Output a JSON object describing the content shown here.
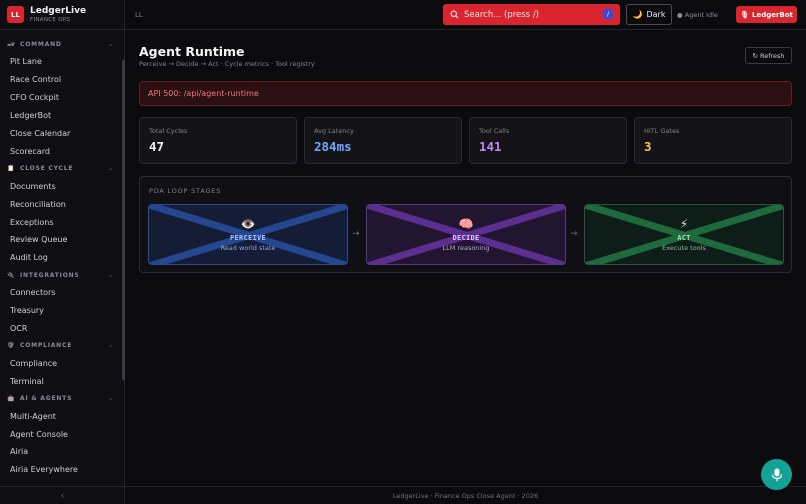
{
  "brand": {
    "logo": "LL",
    "title": "LedgerLive",
    "subtitle": "FINANCE OPS"
  },
  "header": {
    "breadcrumb": "LL",
    "search_placeholder": "Search... (press /)",
    "search_shortcut": "/",
    "theme_label": "Dark",
    "agent_status": "Agent Idle",
    "ledgerbot_label": "LedgerBot"
  },
  "sidebar": {
    "sections": [
      {
        "label": "COMMAND",
        "icon": "racecar-icon",
        "items": [
          "Pit Lane",
          "Race Control",
          "CFO Cockpit",
          "LedgerBot",
          "Close Calendar",
          "Scorecard"
        ]
      },
      {
        "label": "CLOSE CYCLE",
        "icon": "clipboard-icon",
        "items": [
          "Documents",
          "Reconciliation",
          "Exceptions",
          "Review Queue",
          "Audit Log"
        ]
      },
      {
        "label": "INTEGRATIONS",
        "icon": "plug-icon",
        "items": [
          "Connectors",
          "Treasury",
          "OCR"
        ]
      },
      {
        "label": "COMPLIANCE",
        "icon": "shield-icon",
        "items": [
          "Compliance",
          "Terminal"
        ]
      },
      {
        "label": "AI & AGENTS",
        "icon": "robot-icon",
        "items": [
          "Multi-Agent",
          "Agent Console",
          "Airia",
          "Airia Everywhere"
        ]
      }
    ]
  },
  "page": {
    "title": "Agent Runtime",
    "subtitle": "Perceive → Decide → Act · Cycle metrics · Tool registry",
    "refresh_label": "↻ Refresh",
    "error": "API 500: /api/agent-runtime"
  },
  "stats": [
    {
      "label": "Total Cycles",
      "value": "47",
      "color": "#f2f2f4"
    },
    {
      "label": "Avg Latency",
      "value": "284ms",
      "color": "#6ea8fe"
    },
    {
      "label": "Tool Calls",
      "value": "141",
      "color": "#b98af0"
    },
    {
      "label": "HITL Gates",
      "value": "3",
      "color": "#f5c542"
    }
  ],
  "pda": {
    "title": "PDA LOOP STAGES",
    "stages": [
      {
        "name": "PERCEIVE",
        "desc": "Read world state",
        "icon": "eye-icon",
        "glyph": "👁️",
        "fill": "#141d35",
        "border": "#2a4a8c",
        "x_color": "#24478f",
        "name_color": "#a9c4ff",
        "desc_color": "#8fa8d8"
      },
      {
        "name": "DECIDE",
        "desc": "LLM reasoning",
        "icon": "brain-icon",
        "glyph": "🧠",
        "fill": "#21152f",
        "border": "#5a3585",
        "x_color": "#5b2f8f",
        "name_color": "#e0c8ff",
        "desc_color": "#b9a2d6"
      },
      {
        "name": "ACT",
        "desc": "Execute tools",
        "icon": "lightning-icon",
        "glyph": "⚡",
        "fill": "#0f1d18",
        "border": "#27543d",
        "x_color": "#1f6a3c",
        "name_color": "#9fe0b8",
        "desc_color": "#7fbf98"
      }
    ]
  },
  "footer": {
    "text": "LedgerLive · Finance Ops Close Agent · 2026"
  }
}
